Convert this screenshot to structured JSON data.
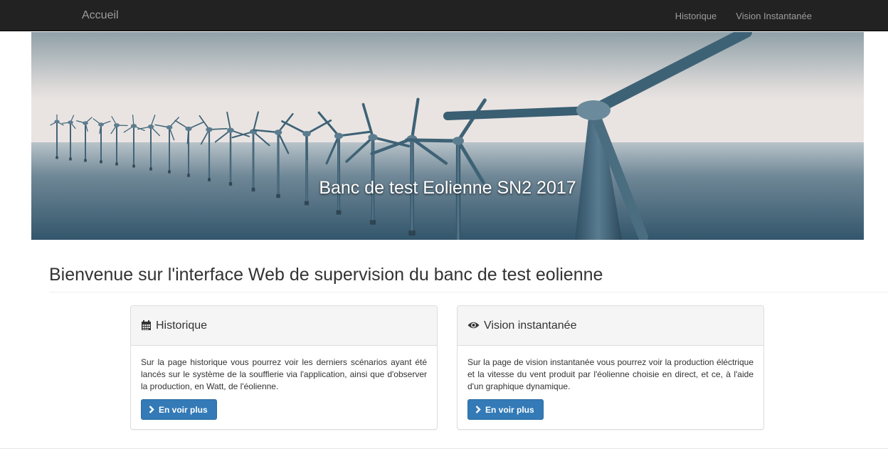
{
  "navbar": {
    "brand": "Accueil",
    "links": [
      "Historique",
      "Vision Instantanée"
    ]
  },
  "hero": {
    "caption": "Banc de test Eolienne SN2 2017"
  },
  "main": {
    "title": "Bienvenue sur l'interface Web de supervision du banc de test eolienne"
  },
  "panels": [
    {
      "icon": "calendar-icon",
      "title": "Historique",
      "text": "Sur la page historique vous pourrez voir les derniers scénarios ayant été lancés sur le système de la soufflerie via l'application, ainsi que d'observer la production, en Watt, de l'éolienne.",
      "button": "En voir plus"
    },
    {
      "icon": "eye-icon",
      "title": "Vision instantanée",
      "text": "Sur la page de vision instantanée vous pourrez voir la production éléctrique et la vitesse du vent produit par l'éolienne choisie en direct, et ce, à l'aide d'un graphique dynamique.",
      "button": "En voir plus"
    }
  ],
  "colors": {
    "navbar": "#222222",
    "primary": "#337ab7"
  }
}
